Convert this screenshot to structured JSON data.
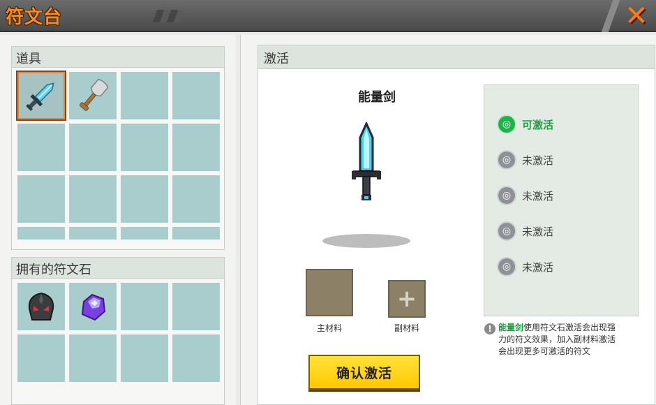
{
  "title": "符文台",
  "close_icon": "close-x-icon",
  "accent": "#ff8a1e",
  "items_panel": {
    "title": "道具",
    "slots": [
      {
        "item": "sword-icon",
        "selected": true
      },
      {
        "item": "shovel-icon",
        "selected": false
      },
      {
        "item": "",
        "selected": false
      },
      {
        "item": "",
        "selected": false
      }
    ]
  },
  "runes_panel": {
    "title": "拥有的符文石",
    "slots": [
      {
        "item": "dark-helmet-icon"
      },
      {
        "item": "purple-crystal-icon"
      }
    ]
  },
  "activate_panel": {
    "title": "激活",
    "weapon_name": "能量剑",
    "main_material_label": "主材料",
    "sub_material_label": "副材料",
    "confirm_label": "确认激活",
    "rune_states": [
      {
        "label": "可激活",
        "active": true
      },
      {
        "label": "未激活",
        "active": false
      },
      {
        "label": "未激活",
        "active": false
      },
      {
        "label": "未激活",
        "active": false
      },
      {
        "label": "未激活",
        "active": false
      }
    ],
    "info_highlight": "能量剑",
    "info_text": "使用符文石激活会出现强力的符文效果，加入副材料激活会出现更多可激活的符文"
  }
}
